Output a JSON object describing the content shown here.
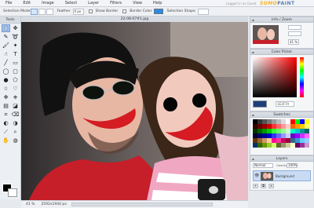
{
  "menu": {
    "items": [
      "File",
      "Edit",
      "Image",
      "Select",
      "Layer",
      "Filters",
      "View",
      "Help"
    ],
    "logged_in": "Logged in as Guest",
    "brand_a": "SUMO",
    "brand_b": "PAINT"
  },
  "options": {
    "selection_mode_label": "Selection Mode",
    "feather_label": "Feather",
    "feather_value": "0 px",
    "show_border_label": "Show Border",
    "border_color_label": "Border Color",
    "border_color": "#2b8be5",
    "selection_shape_label": "Selection Shape"
  },
  "tools": {
    "header": "Tools",
    "icons": [
      "select-rect-icon",
      "move-icon",
      "pencil-icon",
      "lasso-icon",
      "brush-icon",
      "magic-wand-icon",
      "smudge-icon",
      "text-icon",
      "line-icon",
      "rectangle-icon",
      "ellipse-icon",
      "rounded-rect-icon",
      "circle-icon",
      "polygon-icon",
      "star-icon",
      "heart-icon",
      "spray-icon",
      "stamp-icon",
      "gradient-icon",
      "bucket-icon",
      "crop-icon",
      "eraser-icon",
      "dodge-icon",
      "burn-icon",
      "eyedropper-icon",
      "zoom-icon",
      "hand-icon",
      "blur-icon"
    ],
    "glyphs": [
      "⬚",
      "✥",
      "✎",
      "➰",
      "🖌",
      "✦",
      "☝",
      "T",
      "╱",
      "▭",
      "◯",
      "▢",
      "●",
      "⬠",
      "☆",
      "♡",
      "❉",
      "⎈",
      "▤",
      "◪",
      "⌗",
      "⌫",
      "◐",
      "◑",
      "⟋",
      "⌕",
      "✋",
      "◍"
    ]
  },
  "document": {
    "title": "22-08-07#1.jpg",
    "zoom": "41 %",
    "dimensions": "2592x1944 px"
  },
  "panels": {
    "info_title": "Info / Zoom",
    "info_zoom": "41 %",
    "picker_title": "Color Picker",
    "picker_hex": "1E3F7A",
    "picker_current": "#1e3f7a",
    "swatches_title": "Swatches",
    "layers_title": "Layers",
    "blend_mode": "Normal",
    "opacity_label": "Opacity",
    "opacity_value": "100%",
    "layer_name": "Background"
  },
  "swatches": [
    "#000000",
    "#333333",
    "#555555",
    "#777777",
    "#999999",
    "#bbbbbb",
    "#dddddd",
    "#ffffff",
    "#ff0000",
    "#00ff00",
    "#0000ff",
    "#ffff00",
    "#330000",
    "#660000",
    "#990000",
    "#cc0000",
    "#ff3333",
    "#ff6666",
    "#ff9999",
    "#ffcccc",
    "#ff6600",
    "#ff9900",
    "#ffcc00",
    "#ffff66",
    "#003300",
    "#006600",
    "#009900",
    "#00cc00",
    "#33ff33",
    "#66ff66",
    "#99ff99",
    "#ccffcc",
    "#00ffcc",
    "#00cccc",
    "#009999",
    "#006666",
    "#000033",
    "#000066",
    "#000099",
    "#0000cc",
    "#3333ff",
    "#6666ff",
    "#9999ff",
    "#ccccff",
    "#6600cc",
    "#9900ff",
    "#cc33ff",
    "#ff66ff",
    "#663300",
    "#996633",
    "#cc9966",
    "#ffcc99",
    "#ff0099",
    "#ff3399",
    "#cc0066",
    "#990033",
    "#336699",
    "#3399cc",
    "#66ccff",
    "#99ccff",
    "#003366",
    "#336600",
    "#669900",
    "#99cc33",
    "#ccff66",
    "#666633",
    "#999966",
    "#cccc99",
    "#ffffcc",
    "#660066",
    "#993399",
    "#cc99cc"
  ]
}
